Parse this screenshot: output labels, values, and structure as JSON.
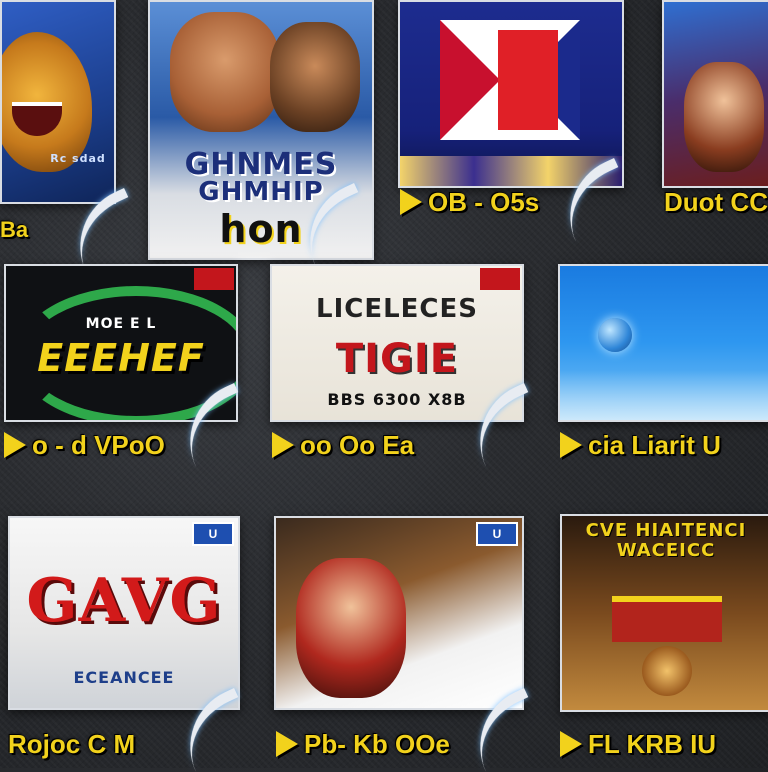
{
  "row1": {
    "tile1": {
      "art_text": "Rc sdad"
    },
    "tile2": {
      "art_title_line1": "GHNMES",
      "art_title_line2": "GHMHIP",
      "art_logo": "hon"
    },
    "tile3": {
      "art_text": "—",
      "caption": "OB - O5s"
    },
    "tile4": {
      "caption": "Duot CC"
    }
  },
  "row2": {
    "tile1": {
      "art_sub": "MOE E L",
      "art_title": "EEEHEF",
      "caption": "o - d VPoO"
    },
    "tile2": {
      "art_title": "LICELECES",
      "art_big": "TIGIE",
      "art_sub": "BBS 6300 X8B",
      "caption": "oo Oo Ea"
    },
    "tile3": {
      "caption": "cia Liarit U"
    }
  },
  "row3": {
    "tile1": {
      "art_title": "GAVG",
      "art_sub": "ECEANCEE",
      "caption": "Rojoc C M"
    },
    "tile2": {
      "caption": "Pb- Kb OOe"
    },
    "tile3": {
      "art_title": "CVE HIAITENCI",
      "art_sub": "WACEICC",
      "caption": "FL KRB IU"
    }
  },
  "colors": {
    "caption_yellow": "#f2d21c",
    "tile_border": "#d9dde3",
    "background": "#2a2c30"
  },
  "icons": [
    "play-icon",
    "swoosh-icon"
  ]
}
